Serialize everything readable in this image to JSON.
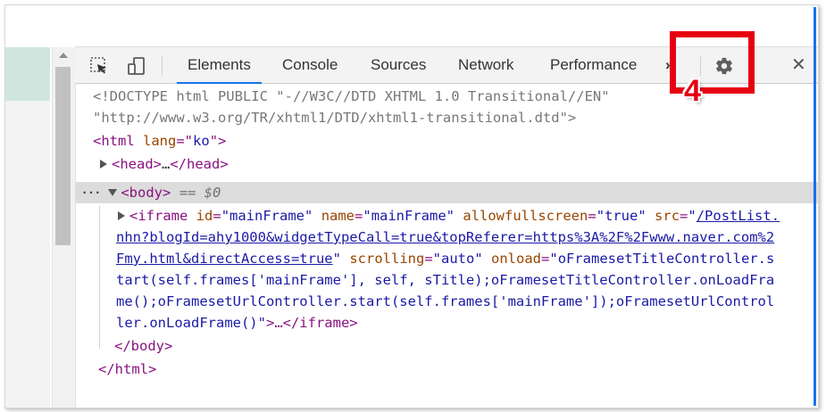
{
  "toolbar": {
    "tabs": [
      "Elements",
      "Console",
      "Sources",
      "Network",
      "Performance"
    ],
    "active_tab": "Elements",
    "more_label": "»",
    "close_label": "✕"
  },
  "annotation": {
    "step_number": "4",
    "color": "#e60012"
  },
  "code": {
    "doctype_line1": "<!DOCTYPE html PUBLIC \"-//W3C//DTD XHTML 1.0 Transitional//EN\"",
    "doctype_line2": "\"http://www.w3.org/TR/xhtml1/DTD/xhtml1-transitional.dtd\">",
    "html_open_tag": "<html",
    "html_attr": "lang",
    "html_attr_eq": "=\"",
    "html_attr_val": "ko",
    "html_close": "\">",
    "head_open": "<head>",
    "head_ellipsis": "…",
    "head_close": "</head>",
    "body_dots": "···",
    "body_tag": "<body>",
    "body_eq": "== $0",
    "iframe_tag": "<iframe",
    "iframe_id_attr": "id",
    "iframe_id_val": "\"mainFrame\"",
    "iframe_name_attr": "name",
    "iframe_name_val": "\"mainFrame\"",
    "iframe_afs_attr": "allowfullscreen",
    "iframe_afs_val": "\"true\"",
    "iframe_src_attr": "src",
    "iframe_src_quote": "\"",
    "src_line1": "/PostList.",
    "src_line2": "nhn?blogId=ahy1000&widgetTypeCall=true&topReferer=https%3A%2F%2Fwww.naver.com%2",
    "src_line3": "Fmy.html&directAccess=true",
    "src_close_quote": "\"",
    "scrolling_attr": "scrolling",
    "scrolling_val": "\"auto\"",
    "onload_attr": "onload",
    "onload_val_start": "\"oFramesetTitleController.s",
    "onload_line4": "tart(self.frames['mainFrame'], self, sTitle);oFramesetTitleController.onLoadFra",
    "onload_line5": "me();oFramesetUrlController.start(self.frames['mainFrame']);oFramesetUrlControl",
    "onload_line6_val": "ler.onLoadFrame()\"",
    "iframe_end": ">…</iframe>",
    "body_close": "</body>",
    "html_close_tag": "</html>"
  }
}
